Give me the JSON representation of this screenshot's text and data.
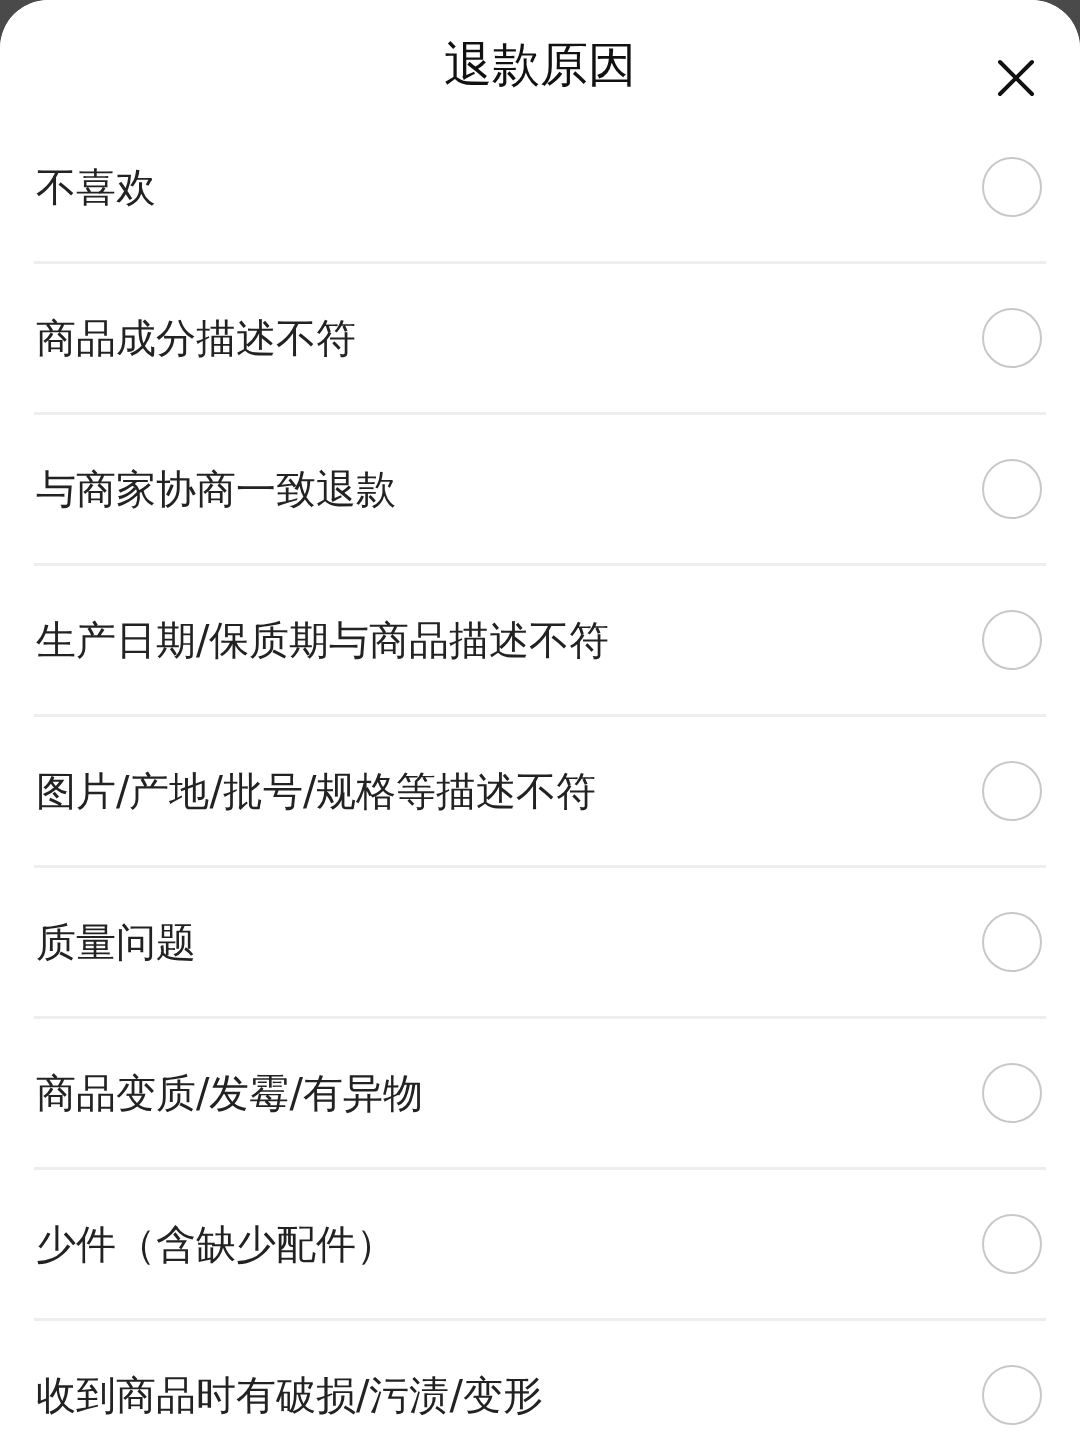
{
  "sheet": {
    "title": "退款原因"
  },
  "reasons": [
    {
      "label": "不喜欢",
      "selected": false
    },
    {
      "label": "商品成分描述不符",
      "selected": false
    },
    {
      "label": "与商家协商一致退款",
      "selected": false
    },
    {
      "label": "生产日期/保质期与商品描述不符",
      "selected": false
    },
    {
      "label": "图片/产地/批号/规格等描述不符",
      "selected": false
    },
    {
      "label": "质量问题",
      "selected": false
    },
    {
      "label": "商品变质/发霉/有异物",
      "selected": false
    },
    {
      "label": "少件（含缺少配件）",
      "selected": false
    },
    {
      "label": "收到商品时有破损/污渍/变形",
      "selected": false
    }
  ]
}
